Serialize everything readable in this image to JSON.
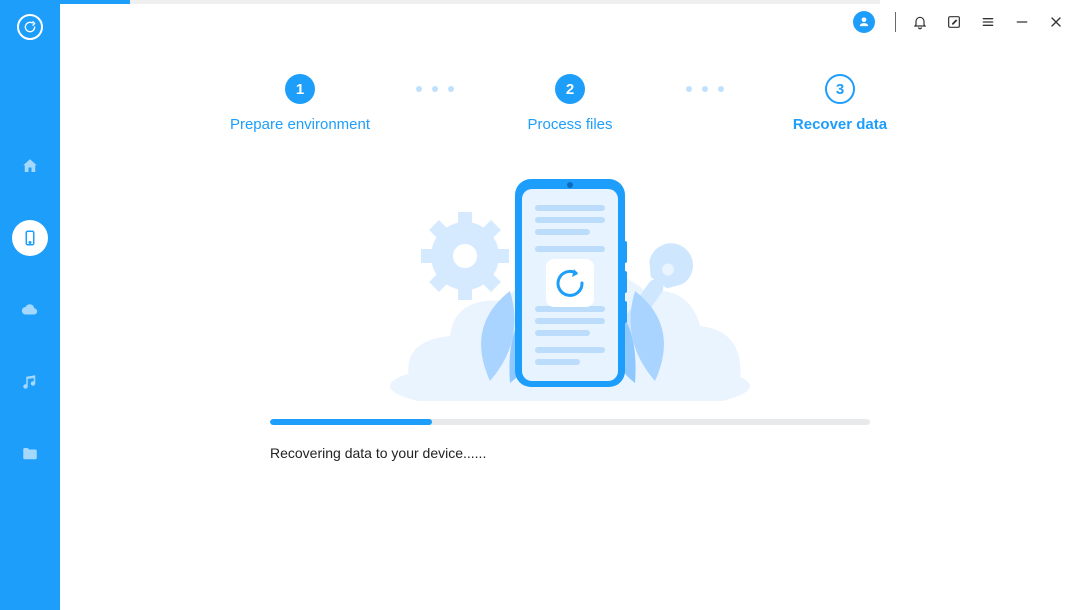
{
  "sidebar": {
    "items": [
      {
        "name": "home"
      },
      {
        "name": "device",
        "active": true
      },
      {
        "name": "cloud"
      },
      {
        "name": "music"
      },
      {
        "name": "folder"
      }
    ]
  },
  "steps": [
    {
      "num": "1",
      "label": "Prepare environment",
      "state": "done"
    },
    {
      "num": "2",
      "label": "Process files",
      "state": "done"
    },
    {
      "num": "3",
      "label": "Recover data",
      "state": "active"
    }
  ],
  "progress": {
    "percent": 27,
    "status_text": "Recovering data to your device......"
  },
  "colors": {
    "accent": "#1e9efb",
    "light": "#bfe1fd",
    "pale": "#e7f3ff"
  }
}
